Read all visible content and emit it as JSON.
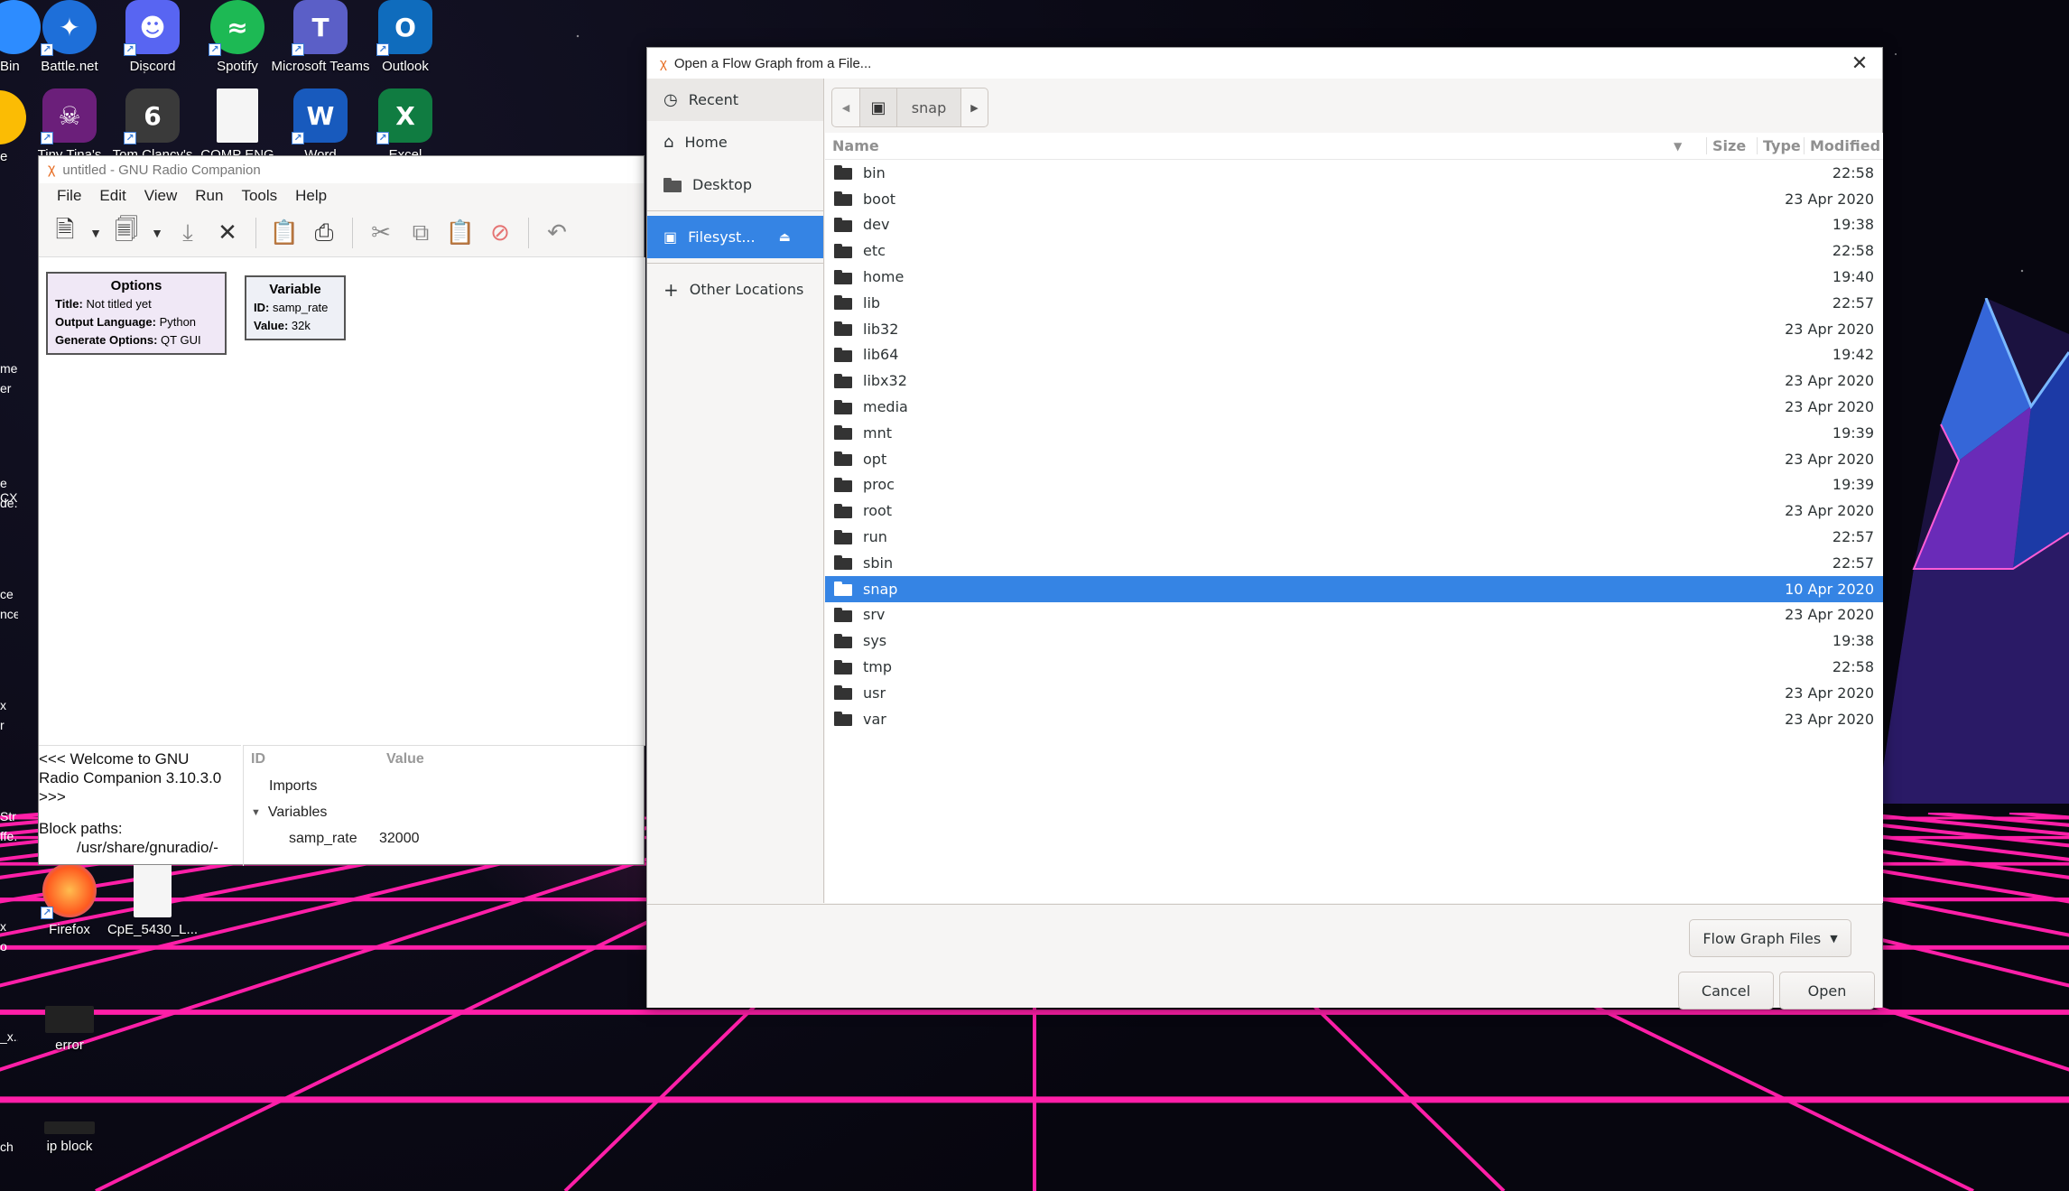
{
  "desktop": {
    "top_icons": [
      {
        "label": "Bin"
      },
      {
        "label": "Battle.net"
      },
      {
        "label": "Discord"
      },
      {
        "label": "Spotify"
      },
      {
        "label": "Microsoft Teams"
      },
      {
        "label": "Outlook"
      }
    ],
    "row2_icons": [
      {
        "label": "e"
      },
      {
        "label": "Tiny Tina's"
      },
      {
        "label": "Tom Clancy's"
      },
      {
        "label": "COMP ENG"
      },
      {
        "label": "Word"
      },
      {
        "label": "Excel"
      }
    ],
    "bottom_icons": [
      {
        "label": "Firefox"
      },
      {
        "label": "CpE_5430_L..."
      },
      {
        "label": "error"
      },
      {
        "label": "ip block"
      }
    ],
    "left_edge_labels": [
      "mes",
      "er",
      "e CX",
      "de...",
      "ce",
      "nce",
      "x",
      "r",
      "Str",
      "ffe...",
      "x",
      "o",
      "_x...",
      "ch"
    ]
  },
  "grc": {
    "title": "untitled - GNU Radio Companion",
    "menu": [
      "File",
      "Edit",
      "View",
      "Run",
      "Tools",
      "Help"
    ],
    "options_block": {
      "title": "Options",
      "lines": [
        {
          "k": "Title:",
          "v": "Not titled yet"
        },
        {
          "k": "Output Language:",
          "v": "Python"
        },
        {
          "k": "Generate Options:",
          "v": "QT GUI"
        }
      ]
    },
    "variable_block": {
      "title": "Variable",
      "lines": [
        {
          "k": "ID:",
          "v": "samp_rate"
        },
        {
          "k": "Value:",
          "v": "32k"
        }
      ]
    },
    "console": {
      "line1": "<<< Welcome to GNU",
      "line2": "Radio Companion 3.10.3.0",
      "line3": ">>>",
      "line4": "Block paths:",
      "line5": "/usr/share/gnuradio/-"
    },
    "vars_table": {
      "col_id": "ID",
      "col_value": "Value",
      "imports": "Imports",
      "variables": "Variables",
      "var_name": "samp_rate",
      "var_value": "32000"
    }
  },
  "dialog": {
    "title": "Open a Flow Graph from a File...",
    "sidebar": {
      "recent": "Recent",
      "home": "Home",
      "desktop": "Desktop",
      "filesystem": "Filesyst...",
      "other": "Other Locations"
    },
    "path": {
      "current": "snap"
    },
    "columns": {
      "name": "Name",
      "size": "Size",
      "type": "Type",
      "modified": "Modified"
    },
    "files": [
      {
        "name": "bin",
        "modified": "22:58"
      },
      {
        "name": "boot",
        "modified": "23 Apr 2020"
      },
      {
        "name": "dev",
        "modified": "19:38"
      },
      {
        "name": "etc",
        "modified": "22:58"
      },
      {
        "name": "home",
        "modified": "19:40"
      },
      {
        "name": "lib",
        "modified": "22:57"
      },
      {
        "name": "lib32",
        "modified": "23 Apr 2020"
      },
      {
        "name": "lib64",
        "modified": "19:42"
      },
      {
        "name": "libx32",
        "modified": "23 Apr 2020"
      },
      {
        "name": "media",
        "modified": "23 Apr 2020"
      },
      {
        "name": "mnt",
        "modified": "19:39"
      },
      {
        "name": "opt",
        "modified": "23 Apr 2020"
      },
      {
        "name": "proc",
        "modified": "19:39"
      },
      {
        "name": "root",
        "modified": "23 Apr 2020"
      },
      {
        "name": "run",
        "modified": "22:57"
      },
      {
        "name": "sbin",
        "modified": "22:57"
      },
      {
        "name": "snap",
        "modified": "10 Apr 2020",
        "selected": true
      },
      {
        "name": "srv",
        "modified": "23 Apr 2020"
      },
      {
        "name": "sys",
        "modified": "19:38"
      },
      {
        "name": "tmp",
        "modified": "22:58"
      },
      {
        "name": "usr",
        "modified": "23 Apr 2020"
      },
      {
        "name": "var",
        "modified": "23 Apr 2020"
      }
    ],
    "filter": "Flow Graph Files",
    "cancel": "Cancel",
    "open": "Open"
  },
  "colors": {
    "accent": "#3584e4",
    "grid_pink": "#ff1fa8"
  }
}
